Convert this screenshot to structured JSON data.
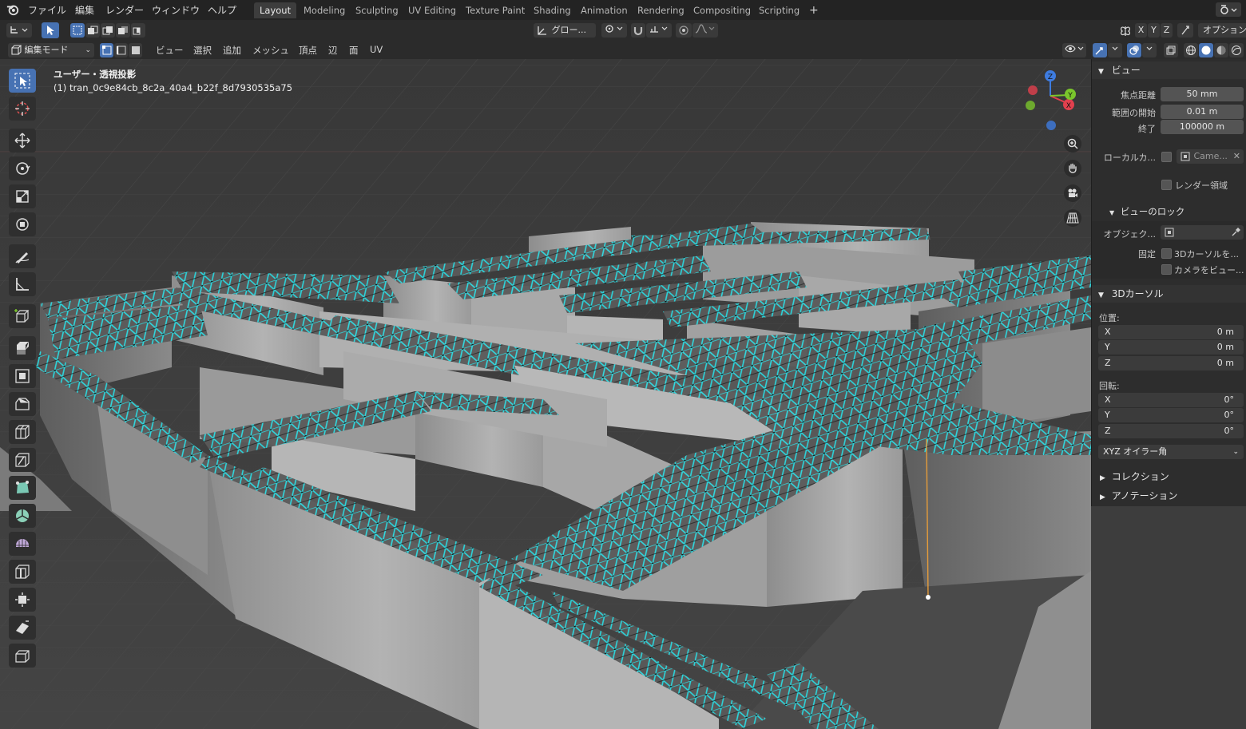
{
  "menu": {
    "items": [
      "ファイル",
      "編集",
      "レンダー",
      "ウィンドウ",
      "ヘルプ"
    ]
  },
  "workspaces": {
    "tabs": [
      "Layout",
      "Modeling",
      "Sculpting",
      "UV Editing",
      "Texture Paint",
      "Shading",
      "Animation",
      "Rendering",
      "Compositing",
      "Scripting"
    ],
    "active": "Layout",
    "add": "+"
  },
  "header2": {
    "transform_orientation": "グロー...",
    "axes": [
      "X",
      "Y",
      "Z"
    ],
    "options": "オプション"
  },
  "header3": {
    "mode": "編集モード",
    "menus": [
      "ビュー",
      "選択",
      "追加",
      "メッシュ",
      "頂点",
      "辺",
      "面",
      "UV"
    ]
  },
  "viewport": {
    "view_name": "ユーザー・透視投影",
    "object_name": "(1) tran_0c9e84cb_8c2a_40a4_b22f_8d7930535a75",
    "gizmo": {
      "x": "X",
      "y": "Y",
      "z": "Z"
    }
  },
  "npanel": {
    "view_section": "ビュー",
    "focal_label": "焦点距離",
    "focal_value": "50 mm",
    "clip_start_label": "範囲の開始",
    "clip_start_value": "0.01 m",
    "clip_end_label": "終了",
    "clip_end_value": "100000 m",
    "local_camera_label": "ローカルカ...",
    "local_camera_value": "Came...",
    "render_region_label": "レンダー領域",
    "view_lock_section": "ビューのロック",
    "lock_object_label": "オブジェク...",
    "lock_label": "固定",
    "lock_cursor_label": "3Dカーソルを...",
    "lock_camera_label": "カメラをビュー...",
    "cursor_section": "3Dカーソル",
    "location_label": "位置:",
    "loc_x_label": "X",
    "loc_x": "0 m",
    "loc_y_label": "Y",
    "loc_y": "0 m",
    "loc_z_label": "Z",
    "loc_z": "0 m",
    "rotation_label": "回転:",
    "rot_x_label": "X",
    "rot_x": "0°",
    "rot_y_label": "Y",
    "rot_y": "0°",
    "rot_z_label": "Z",
    "rot_z": "0°",
    "rotation_mode": "XYZ オイラー角",
    "collection_section": "コレクション",
    "annotation_section": "アノテーション"
  },
  "colors": {
    "accent": "#4772b3",
    "mesh_edge": "#27e0e6",
    "axis_x": "#e2404e",
    "axis_y": "#7ac52c",
    "axis_z": "#3e7ce0"
  }
}
